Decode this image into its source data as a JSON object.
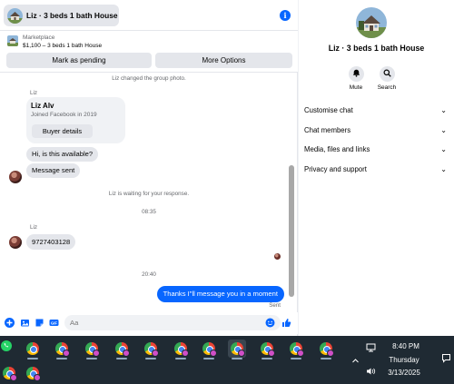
{
  "header": {
    "title": "Liz · 3 beds 1 bath House"
  },
  "marketplace": {
    "label": "Marketplace",
    "listing": "$1,100 – 3 beds 1 bath House",
    "pending_button": "Mark as pending",
    "more_button": "More Options"
  },
  "thread": {
    "group_photo_notice": "Liz changed the group photo.",
    "sender_1": "Liz",
    "card": {
      "name": "Liz Alv",
      "joined": "Joined Facebook in 2019",
      "button": "Buyer details"
    },
    "msg_available": "Hi, is this available?",
    "msg_sent": "Message sent",
    "waiting_notice": "Liz is waiting for your response.",
    "time_1": "08:35",
    "sender_2": "Liz",
    "msg_phone": "9727403128",
    "time_2": "20:40",
    "msg_reply": "Thanks I\"ll message you in a moment",
    "status": "Sent"
  },
  "composer": {
    "placeholder": "Aa"
  },
  "details": {
    "name": "Liz · 3 beds 1 bath House",
    "mute_label": "Mute",
    "search_label": "Search",
    "rows": [
      {
        "label": "Customise chat"
      },
      {
        "label": "Chat members"
      },
      {
        "label": "Media, files and links"
      },
      {
        "label": "Privacy and support"
      }
    ]
  },
  "taskbar": {
    "time": "8:40 PM",
    "day": "Thursday",
    "date": "3/13/2025"
  },
  "colors": {
    "accent": "#0866ff",
    "taskbar": "#1f2a33",
    "bubble_in": "#e4e6eb"
  }
}
